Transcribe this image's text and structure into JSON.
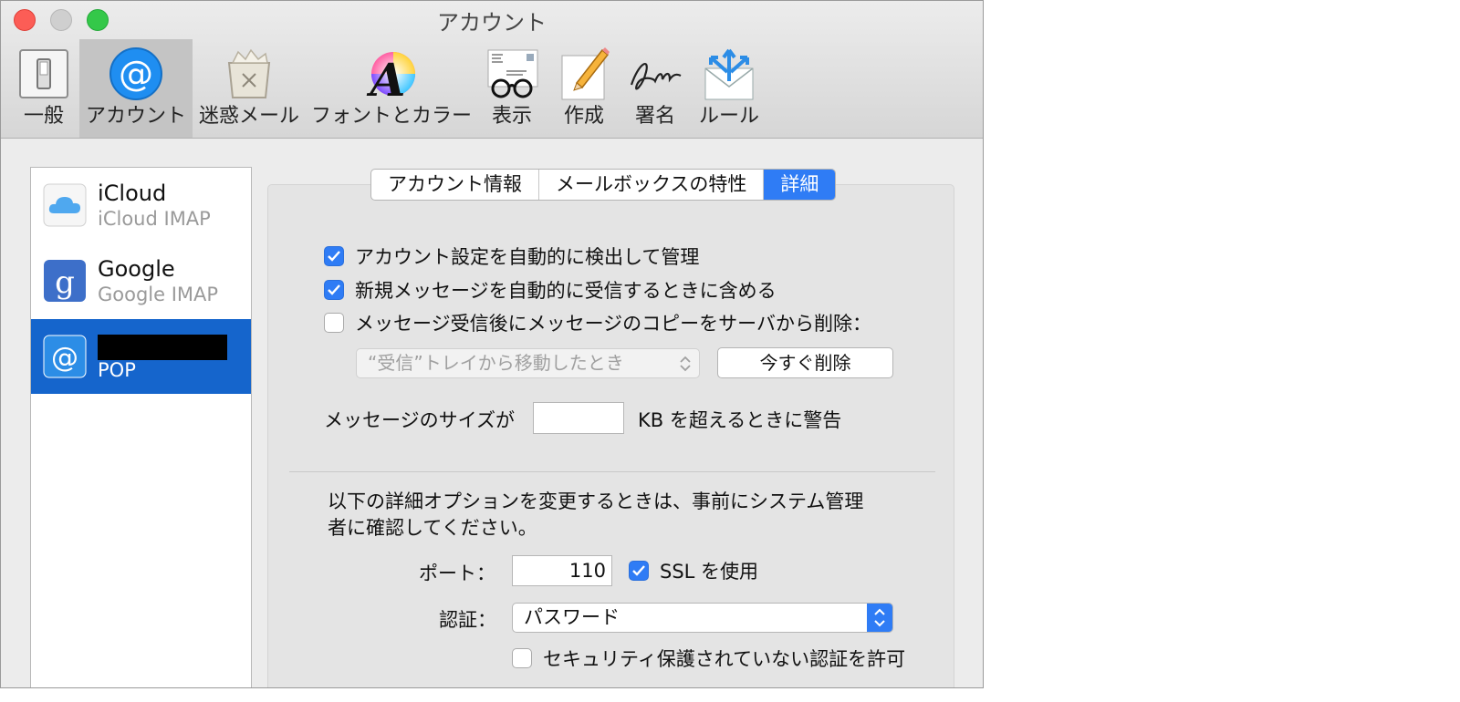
{
  "window": {
    "title": "アカウント"
  },
  "toolbar": {
    "items": [
      {
        "label": "一般",
        "icon": "general-switch-icon"
      },
      {
        "label": "アカウント",
        "icon": "at-sign-icon",
        "selected": true
      },
      {
        "label": "迷惑メール",
        "icon": "junk-trash-icon"
      },
      {
        "label": "フォントとカラー",
        "icon": "font-color-icon"
      },
      {
        "label": "表示",
        "icon": "glasses-icon"
      },
      {
        "label": "作成",
        "icon": "pencil-paper-icon"
      },
      {
        "label": "署名",
        "icon": "signature-icon"
      },
      {
        "label": "ルール",
        "icon": "envelope-arrows-icon"
      }
    ]
  },
  "accounts": [
    {
      "name": "iCloud",
      "type": "iCloud IMAP",
      "icon": "icloud-icon"
    },
    {
      "name": "Google",
      "type": "Google IMAP",
      "icon": "google-icon"
    },
    {
      "name": "",
      "type": "POP",
      "icon": "at-sign-icon",
      "selected": true,
      "name_redacted": true
    }
  ],
  "tabs": [
    {
      "label": "アカウント情報"
    },
    {
      "label": "メールボックスの特性"
    },
    {
      "label": "詳細",
      "active": true
    }
  ],
  "advanced": {
    "auto_detect": {
      "label": "アカウント設定を自動的に検出して管理",
      "checked": true
    },
    "include_auto_fetch": {
      "label": "新規メッセージを自動的に受信するときに含める",
      "checked": true
    },
    "remove_copy": {
      "label": "メッセージ受信後にメッセージのコピーをサーバから削除：",
      "checked": false
    },
    "remove_when": {
      "value": "“受信”トレイから移動したとき",
      "disabled": true
    },
    "remove_now_button": "今すぐ削除",
    "size_warning": {
      "prefix": "メッセージのサイズが",
      "value": "",
      "suffix": "KB を超えるときに警告"
    },
    "notice": [
      "以下の詳細オプションを変更するときは、事前にシステム管理",
      "者に確認してください。"
    ],
    "port": {
      "label": "ポート：",
      "value": "110"
    },
    "ssl": {
      "label": "SSL を使用",
      "checked": true
    },
    "auth": {
      "label": "認証：",
      "value": "パスワード"
    },
    "allow_insecure": {
      "label": "セキュリティ保護されていない認証を許可",
      "checked": false
    }
  },
  "colors": {
    "accent": "#2f7cf5",
    "selection": "#1565cc"
  }
}
